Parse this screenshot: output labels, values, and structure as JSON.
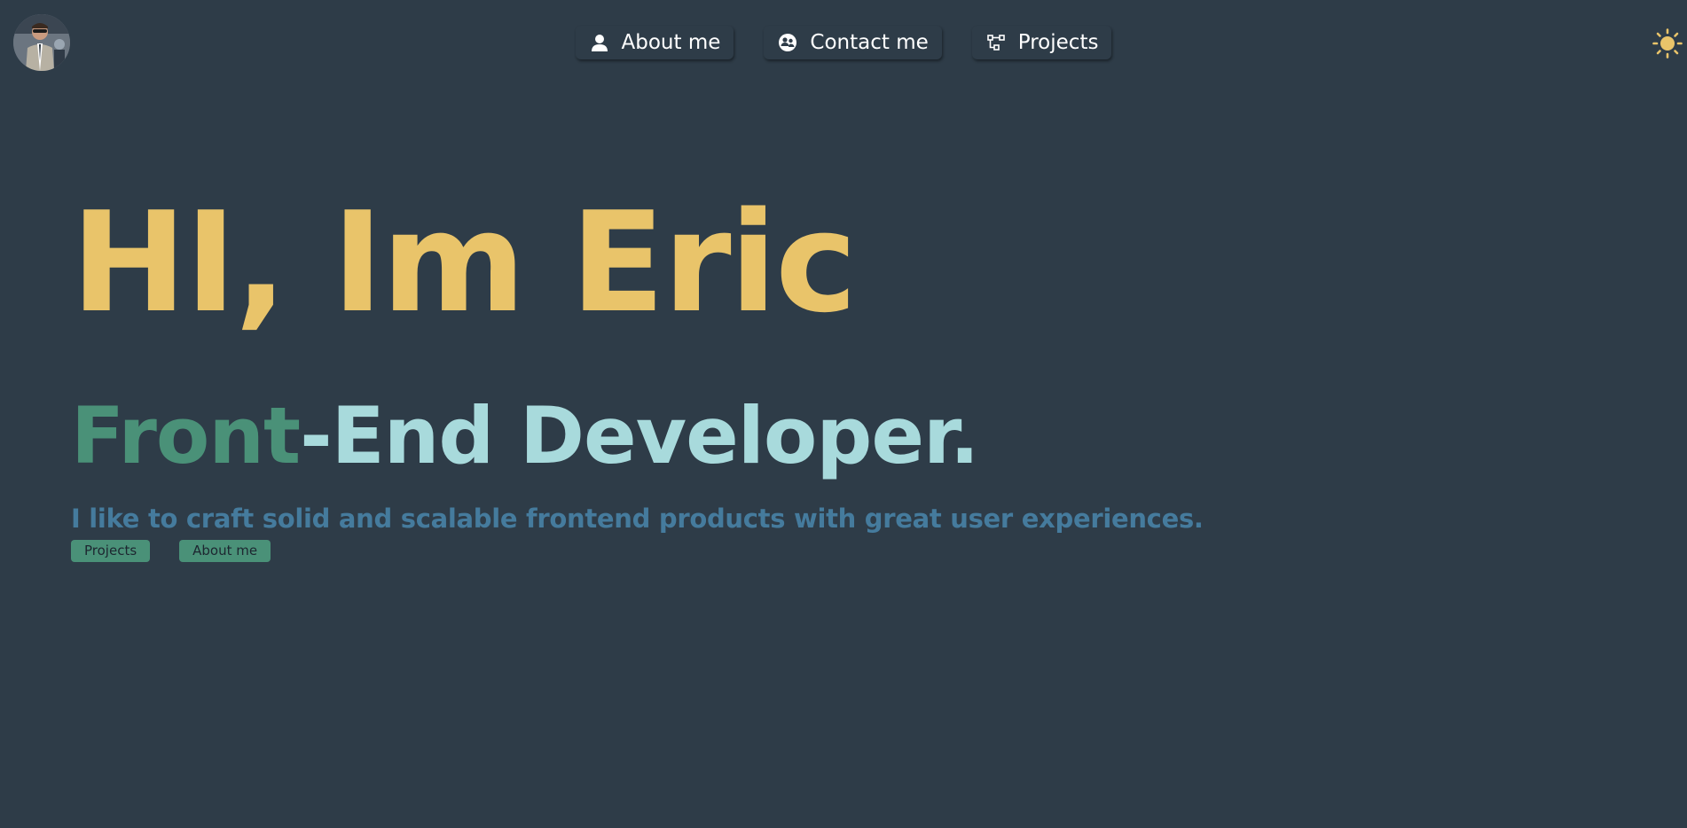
{
  "header": {
    "avatar_alt": "Profile photo",
    "nav": [
      {
        "label": "About me",
        "icon": "user-icon"
      },
      {
        "label": "Contact me",
        "icon": "contact-icon"
      },
      {
        "label": "Projects",
        "icon": "flow-chart-icon"
      }
    ],
    "theme_toggle_icon": "sun-icon"
  },
  "hero": {
    "title": "HI, Im Eric",
    "subtitle_front": "Front",
    "subtitle_rest": "-End Developer.",
    "description": "I like to craft solid and scalable frontend products with great user experiences.",
    "buttons": [
      {
        "label": "Projects"
      },
      {
        "label": "About me"
      }
    ]
  },
  "colors": {
    "background": "#2e3c48",
    "title": "#e9c46a",
    "accent_green": "#4a9178",
    "accent_light": "#a8dadc",
    "description": "#457b9d",
    "nav_text": "#ffffff",
    "sun": "#e9c46a"
  }
}
